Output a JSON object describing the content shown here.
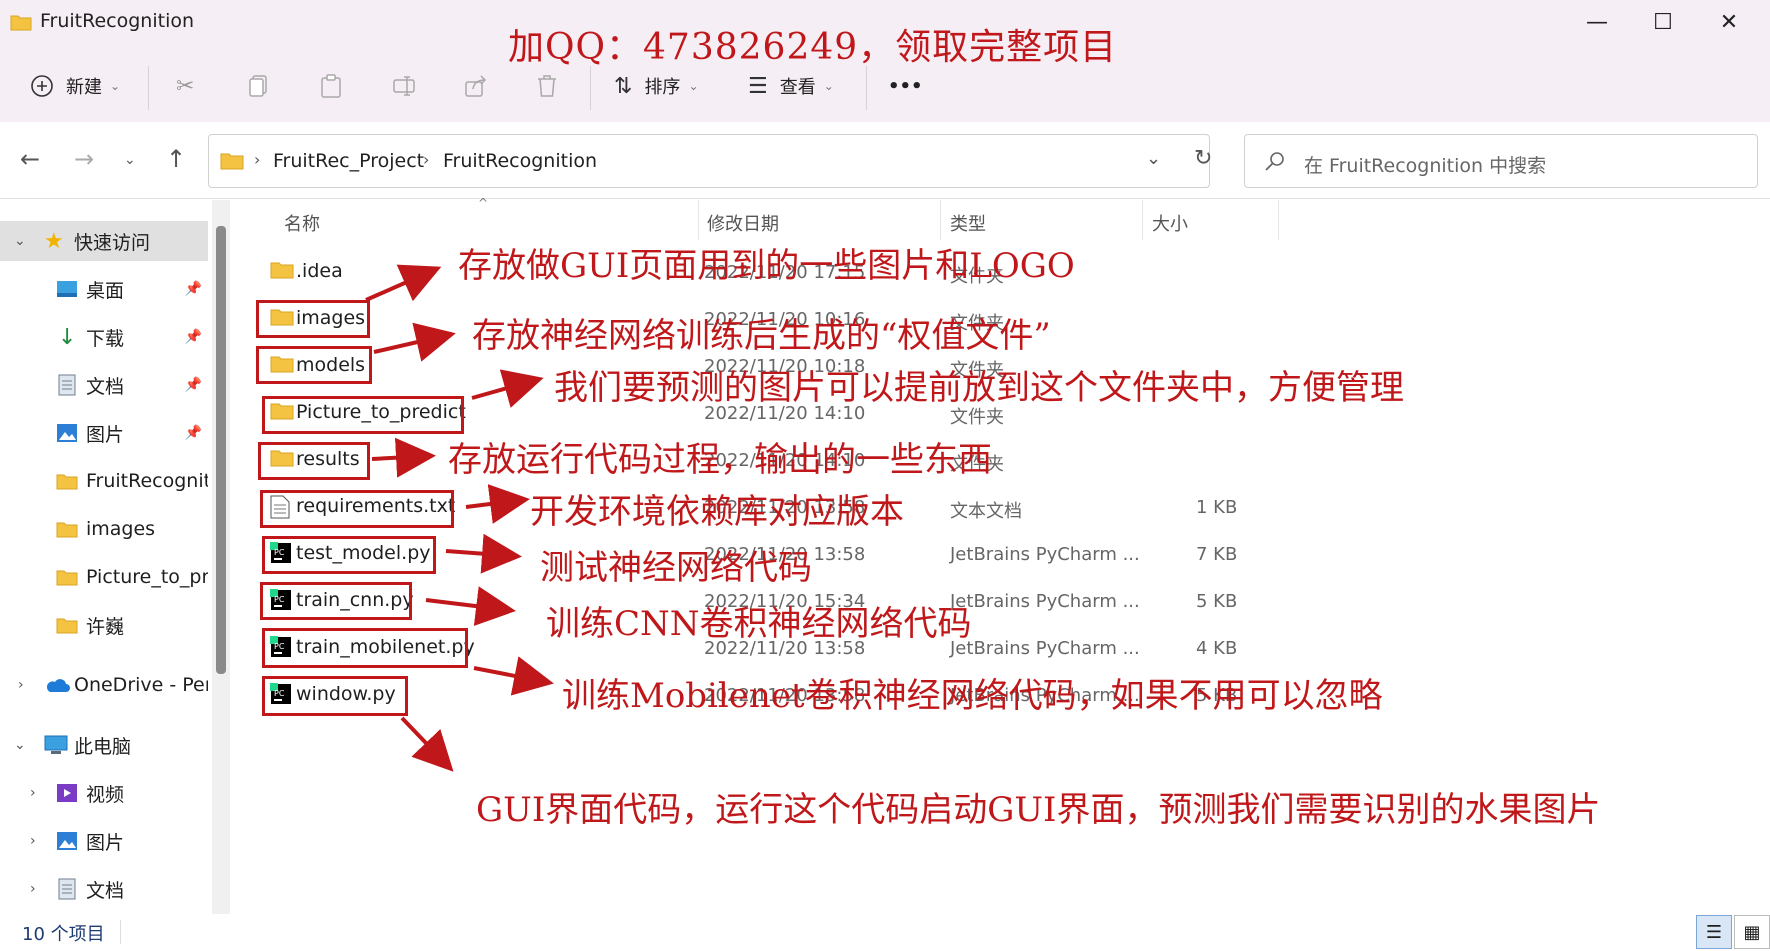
{
  "window": {
    "title": "FruitRecognition",
    "minimize": "—",
    "maximize": "☐",
    "close": "✕"
  },
  "watermark": "加QQ：473826249，领取完整项目",
  "toolbar": {
    "new_label": "新建",
    "sort_label": "排序",
    "view_label": "查看",
    "more_label": "•••"
  },
  "address": {
    "crumbs": [
      "FruitRec_Project",
      "FruitRecognition"
    ],
    "search_placeholder": "在 FruitRecognition 中搜索"
  },
  "sidebar": {
    "items": [
      {
        "label": "快速访问"
      },
      {
        "label": "桌面"
      },
      {
        "label": "下载"
      },
      {
        "label": "文档"
      },
      {
        "label": "图片"
      },
      {
        "label": "FruitRecogniti"
      },
      {
        "label": "images"
      },
      {
        "label": "Picture_to_pre"
      },
      {
        "label": "许巍"
      },
      {
        "label": "OneDrive - Pers"
      },
      {
        "label": "此电脑"
      },
      {
        "label": "视频"
      },
      {
        "label": "图片"
      },
      {
        "label": "文档"
      }
    ]
  },
  "columns": {
    "name": "名称",
    "date": "修改日期",
    "type": "类型",
    "size": "大小"
  },
  "files": [
    {
      "name": ".idea",
      "date": "2022/11/20 17:15",
      "type": "文件夹",
      "size": "",
      "icon": "folder"
    },
    {
      "name": "images",
      "date": "2022/11/20 10:16",
      "type": "文件夹",
      "size": "",
      "icon": "folder"
    },
    {
      "name": "models",
      "date": "2022/11/20 10:18",
      "type": "文件夹",
      "size": "",
      "icon": "folder"
    },
    {
      "name": "Picture_to_predict",
      "date": "2022/11/20 14:10",
      "type": "文件夹",
      "size": "",
      "icon": "folder"
    },
    {
      "name": "results",
      "date": "2022/11/20 14:10",
      "type": "文件夹",
      "size": "",
      "icon": "folder"
    },
    {
      "name": "requirements.txt",
      "date": "2022/11/20 13:58",
      "type": "文本文档",
      "size": "1 KB",
      "icon": "text"
    },
    {
      "name": "test_model.py",
      "date": "2022/11/20 13:58",
      "type": "JetBrains PyCharm ...",
      "size": "7 KB",
      "icon": "pycharm"
    },
    {
      "name": "train_cnn.py",
      "date": "2022/11/20 15:34",
      "type": "JetBrains PyCharm ...",
      "size": "5 KB",
      "icon": "pycharm"
    },
    {
      "name": "train_mobilenet.py",
      "date": "2022/11/20 13:58",
      "type": "JetBrains PyCharm ...",
      "size": "4 KB",
      "icon": "pycharm"
    },
    {
      "name": "window.py",
      "date": "2022/11/20 13:58",
      "type": "JetBrains PyCharm ...",
      "size": "5 KB",
      "icon": "pycharm"
    }
  ],
  "annotations": [
    "存放做GUI页面用到的一些图片和LOGO",
    "存放神经网络训练后生成的“权值文件”",
    "我们要预测的图片可以提前放到这个文件夹中，方便管理",
    "存放运行代码过程，输出的一些东西",
    "开发环境依赖库对应版本",
    "测试神经网络代码",
    "训练CNN卷积神经网络代码",
    "训练Mobilenet卷积神经网络代码，如果不用可以忽略",
    "GUI界面代码，运行这个代码启动GUI界面，预测我们需要识别的水果图片"
  ],
  "status": {
    "item_count": "10 个项目"
  },
  "colors": {
    "annotation_red": "#c0181a",
    "folder_yellow": "#f5c342",
    "titlebar_bg": "#f6eef5"
  }
}
